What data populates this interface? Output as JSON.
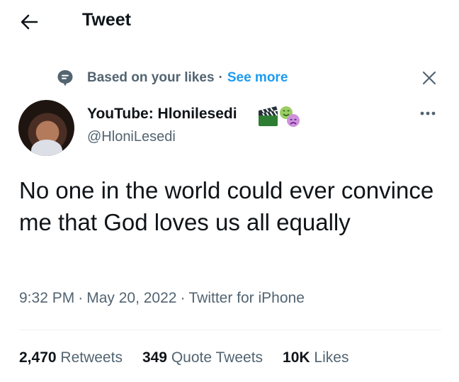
{
  "header": {
    "title": "Tweet",
    "back_icon": "arrow-left-icon"
  },
  "context": {
    "icon": "speech-bubble-icon",
    "text": "Based on your likes",
    "separator": "·",
    "link": "See more",
    "close_icon": "close-icon"
  },
  "author": {
    "display_name": "YouTube: Hlonilesedi",
    "handle": "@HloniLesedi",
    "emojis": [
      "clapper-board-emoji",
      "performing-arts-emoji"
    ],
    "more_icon": "more-horizontal-icon"
  },
  "tweet": {
    "text": "No one in the world could ever convince me that God loves us all equally",
    "time": "9:32 PM",
    "date": "May 20, 2022",
    "source": "Twitter for iPhone",
    "separator": "·"
  },
  "stats": {
    "retweets_count": "2,470",
    "retweets_label": "Retweets",
    "quotes_count": "349",
    "quotes_label": "Quote Tweets",
    "likes_count": "10K",
    "likes_label": "Likes"
  },
  "colors": {
    "text_primary": "#0f1419",
    "text_secondary": "#536471",
    "link": "#1d9bf0",
    "divider": "#eff3f4"
  }
}
